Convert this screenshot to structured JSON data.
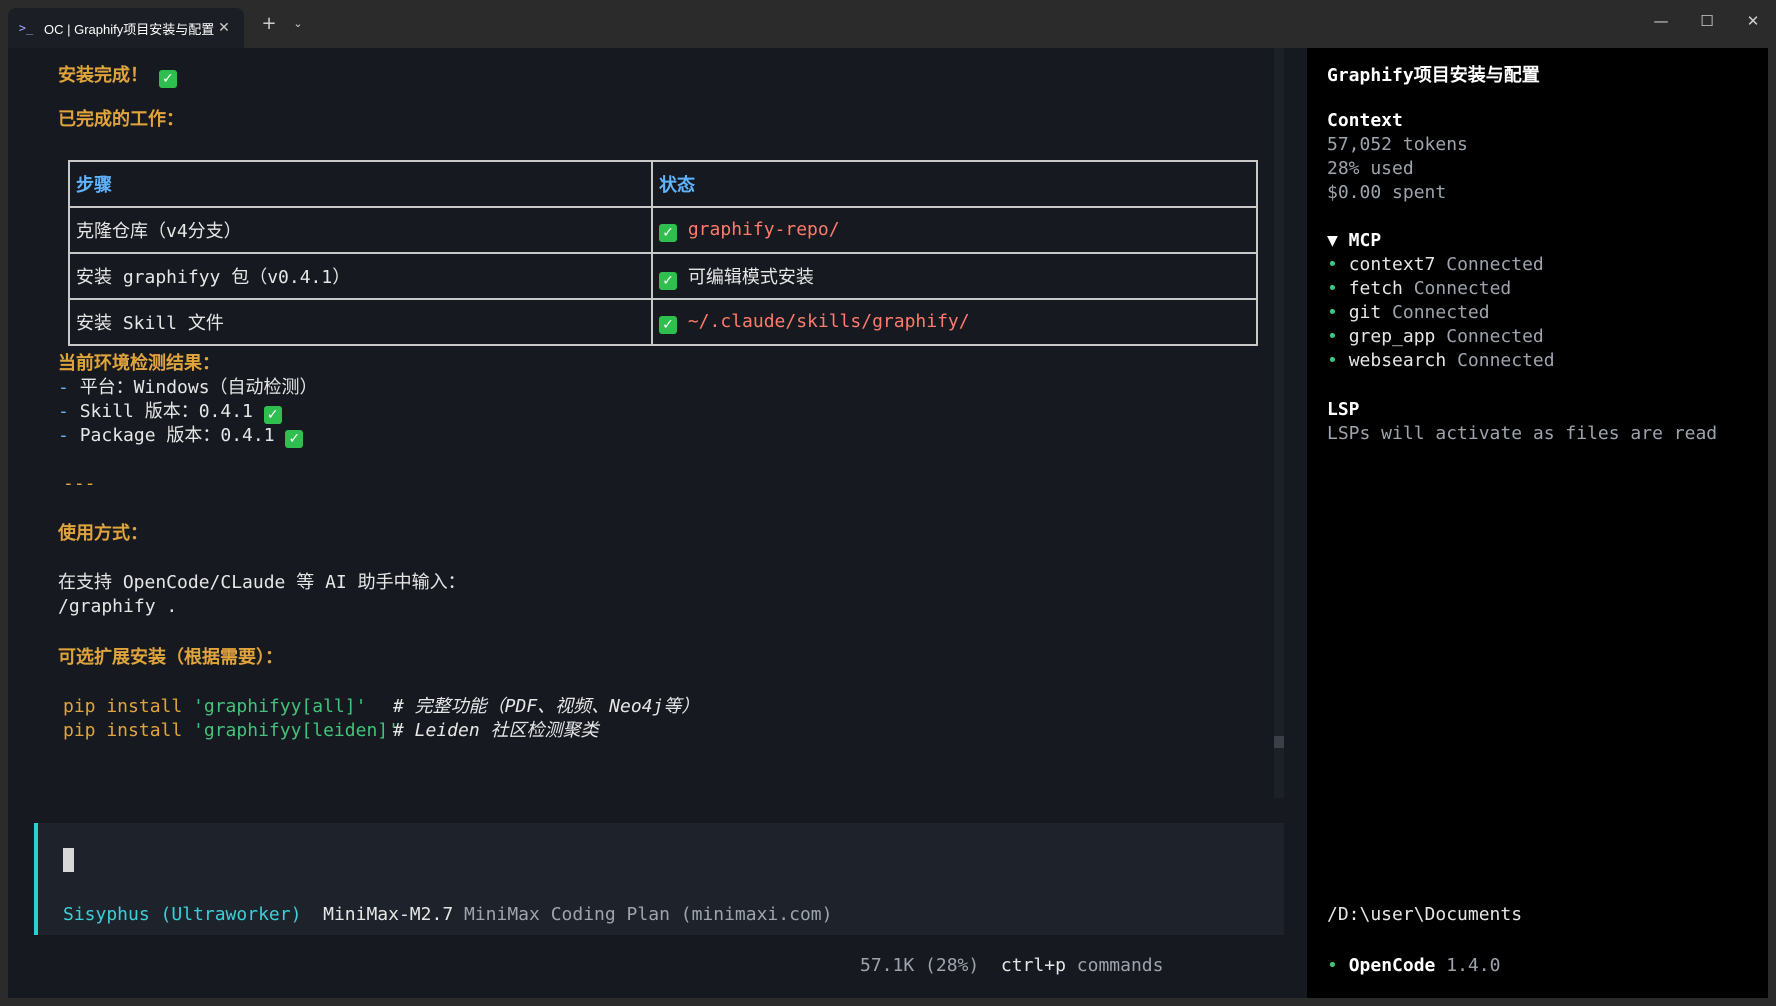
{
  "window": {
    "tab_title": "OC | Graphify项目安装与配置",
    "tab_close": "✕",
    "new_tab": "+",
    "tab_dropdown": "⌄",
    "minimize": "—",
    "maximize": "☐",
    "close": "✕"
  },
  "main": {
    "install_done": "安装完成！",
    "completed_heading": "已完成的工作：",
    "table": {
      "headers": [
        "步骤",
        "状态"
      ],
      "rows": [
        {
          "step": "克隆仓库（v4分支）",
          "status": "graphify-repo/"
        },
        {
          "step": "安装 graphifyy 包（v0.4.1）",
          "status": "可编辑模式安装"
        },
        {
          "step": "安装 Skill 文件",
          "status": "~/.claude/skills/graphify/"
        }
      ]
    },
    "env_heading": "当前环境检测结果：",
    "env_items": [
      {
        "bullet": "-",
        "text": "平台：Windows（自动检测）"
      },
      {
        "bullet": "-",
        "text": "Skill 版本：0.4.1"
      },
      {
        "bullet": "-",
        "text": "Package 版本：0.4.1"
      }
    ],
    "divider": "---",
    "usage_heading": "使用方式：",
    "usage_line1": "在支持 OpenCode/CLaude 等 AI 助手中输入：",
    "usage_line2": "/graphify .",
    "optional_heading": "可选扩展安装（根据需要）：",
    "pip_lines": [
      {
        "cmd": "pip install ",
        "pkg": "'graphifyy[all]'",
        "comment": "# 完整功能（PDF、视频、Neo4j等）"
      },
      {
        "cmd": "pip install ",
        "pkg": "'graphifyy[leiden]'",
        "comment": "# Leiden 社区检测聚类"
      }
    ],
    "agent": "Sisyphus (Ultraworker)",
    "model": "MiniMax-M2.7",
    "provider": "MiniMax Coding Plan (minimaxi.com)",
    "usage_stat": "57.1K (28%)",
    "shortcut_key": "ctrl+p",
    "shortcut_label": "commands"
  },
  "sidebar": {
    "title": "Graphify项目安装与配置",
    "context_heading": "Context",
    "tokens": "57,052 tokens",
    "used": "28% used",
    "spent": "$0.00 spent",
    "mcp_heading": "▼ MCP",
    "mcp_items": [
      {
        "name": "context7",
        "status": "Connected"
      },
      {
        "name": "fetch",
        "status": "Connected"
      },
      {
        "name": "git",
        "status": "Connected"
      },
      {
        "name": "grep_app",
        "status": "Connected"
      },
      {
        "name": "websearch",
        "status": "Connected"
      }
    ],
    "lsp_heading": "LSP",
    "lsp_text": "LSPs will activate as files are read",
    "path": "/D:\\user\\Documents",
    "app_name": "OpenCode",
    "app_version": "1.4.0"
  },
  "colors": {
    "heading_yellow": "#e0a43c",
    "header_blue": "#5fb3ff",
    "path_red": "#ff7a6b",
    "agent_cyan": "#3ccfd8",
    "status_green": "#42c37a",
    "check_green": "#2fbf4f"
  },
  "icons": [
    "terminal-icon",
    "check-icon",
    "bullet-dot-icon"
  ]
}
